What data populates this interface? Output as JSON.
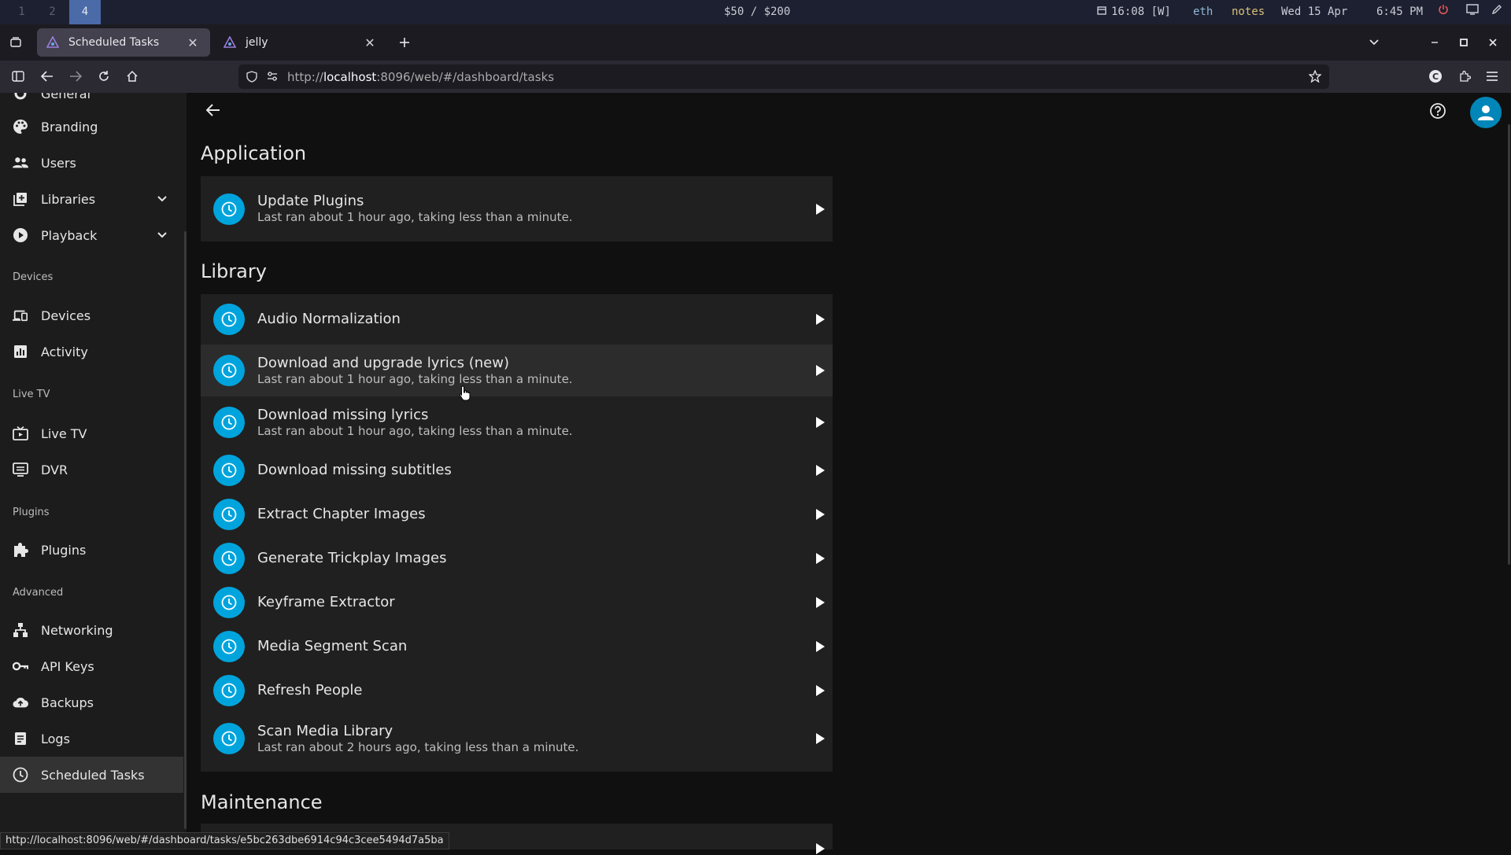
{
  "system_bar": {
    "workspaces": [
      "1",
      "2",
      "4"
    ],
    "active_workspace": "4",
    "budget": "$50 / $200",
    "clock_mode": "16:08 [W]",
    "network": "eth",
    "notes": "notes",
    "date": "Wed 15 Apr",
    "time": "6:45 PM"
  },
  "browser": {
    "tabs": [
      {
        "title": "Scheduled Tasks",
        "active": true
      },
      {
        "title": "jelly",
        "active": false
      }
    ],
    "url_prefix": "http://",
    "url_host": "localhost",
    "url_rest": ":8096/web/#/dashboard/tasks",
    "status_url": "http://localhost:8096/web/#/dashboard/tasks/e5bc263dbe6914c94c3cee5494d7a5ba"
  },
  "sidebar": {
    "partial_item": "General",
    "items": {
      "branding": "Branding",
      "users": "Users",
      "libraries": "Libraries",
      "playback": "Playback",
      "devices": "Devices",
      "activity": "Activity",
      "live_tv": "Live TV",
      "dvr": "DVR",
      "plugins": "Plugins",
      "networking": "Networking",
      "api_keys": "API Keys",
      "backups": "Backups",
      "logs": "Logs",
      "scheduled_tasks": "Scheduled Tasks"
    },
    "headers": {
      "devices": "Devices",
      "live_tv": "Live TV",
      "plugins": "Plugins",
      "advanced": "Advanced"
    }
  },
  "main": {
    "sections": {
      "application": "Application",
      "library": "Library",
      "maintenance": "Maintenance"
    },
    "application_tasks": [
      {
        "name": "Update Plugins",
        "status": "Last ran about 1 hour ago, taking less than a minute."
      }
    ],
    "library_tasks": [
      {
        "name": "Audio Normalization",
        "status": ""
      },
      {
        "name": "Download and upgrade lyrics (new)",
        "status": "Last ran about 1 hour ago, taking less than a minute."
      },
      {
        "name": "Download missing lyrics",
        "status": "Last ran about 1 hour ago, taking less than a minute."
      },
      {
        "name": "Download missing subtitles",
        "status": ""
      },
      {
        "name": "Extract Chapter Images",
        "status": ""
      },
      {
        "name": "Generate Trickplay Images",
        "status": ""
      },
      {
        "name": "Keyframe Extractor",
        "status": ""
      },
      {
        "name": "Media Segment Scan",
        "status": ""
      },
      {
        "name": "Refresh People",
        "status": ""
      },
      {
        "name": "Scan Media Library",
        "status": "Last ran about 2 hours ago, taking less than a minute."
      }
    ]
  },
  "colors": {
    "accent": "#00a4dc",
    "avatar": "#0086b8"
  },
  "icons": {
    "task": "clock-icon",
    "run": "play-icon",
    "back": "back-arrow-icon",
    "help": "help-icon",
    "user": "user-avatar-icon"
  }
}
